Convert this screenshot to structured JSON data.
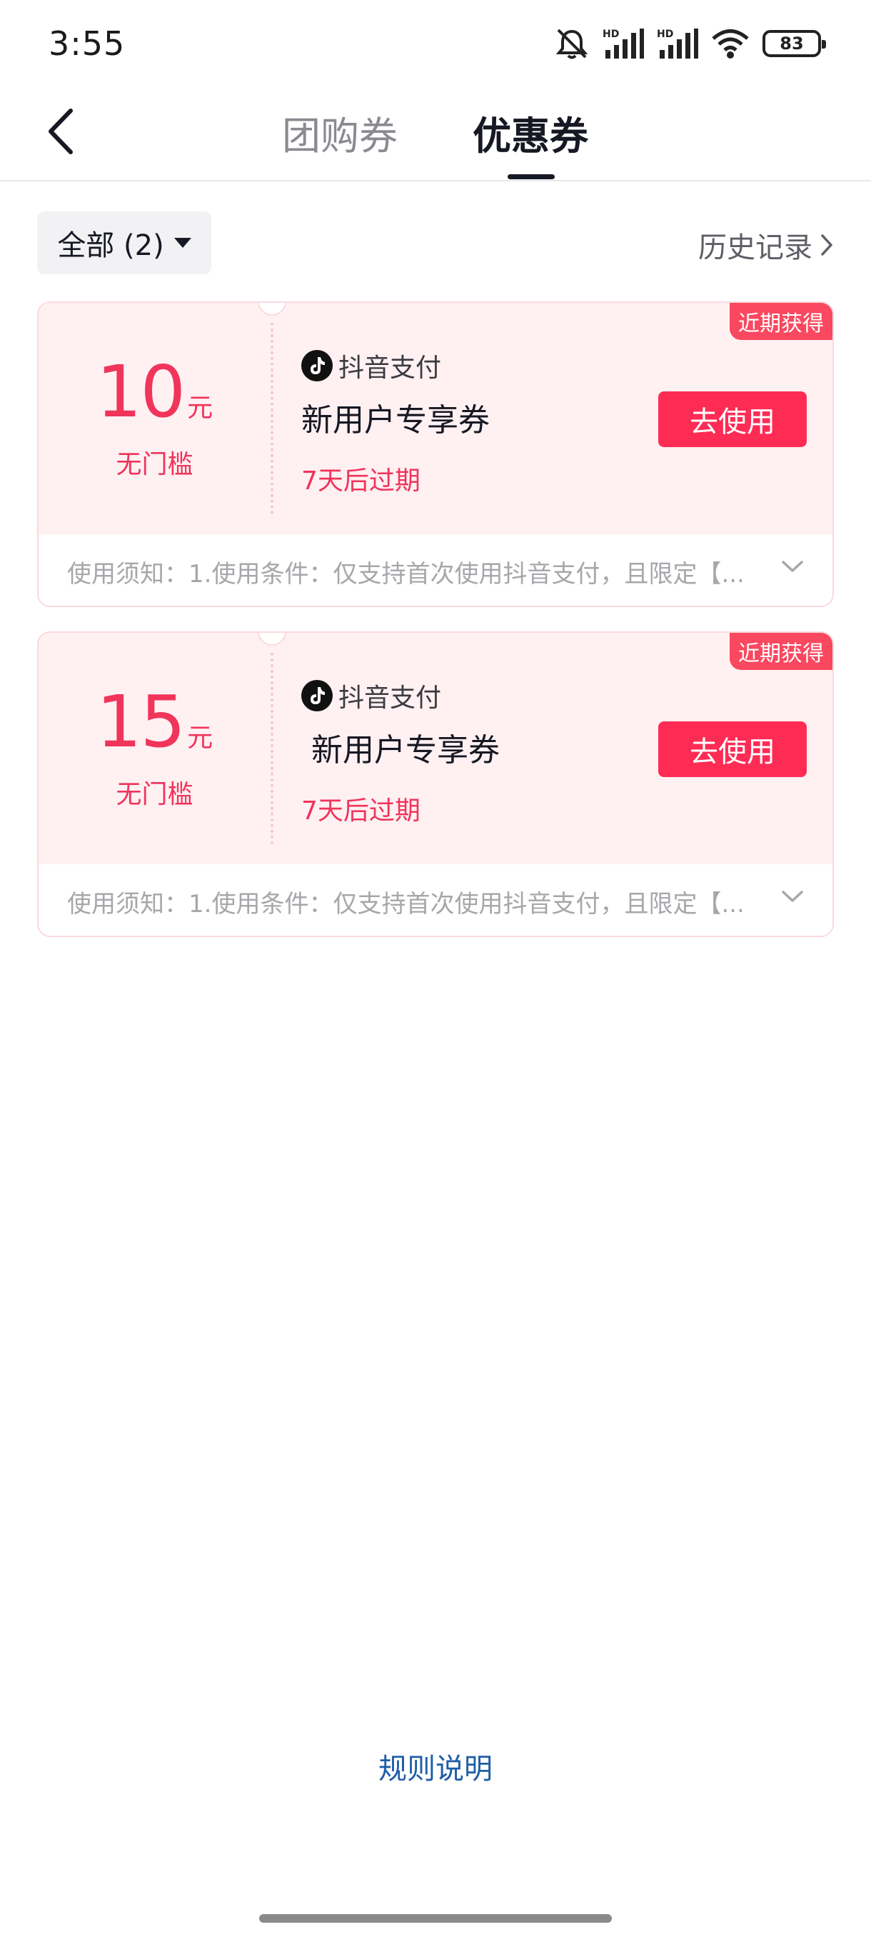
{
  "status_bar": {
    "time": "3:55",
    "battery_level": "83",
    "icons": [
      "mute-icon",
      "signal-hd-icon",
      "signal-hd-icon",
      "wifi-icon",
      "battery-icon"
    ]
  },
  "nav": {
    "tabs": [
      {
        "label": "团购券",
        "active": false
      },
      {
        "label": "优惠券",
        "active": true
      }
    ]
  },
  "filter": {
    "label": "全部 (2)",
    "history_label": "历史记录"
  },
  "coupons": [
    {
      "amount": "10",
      "unit": "元",
      "threshold": "无门槛",
      "brand": "抖音支付",
      "title": "新用户专享券",
      "expiry": "7天后过期",
      "button": "去使用",
      "badge": "近期获得",
      "notice": "使用须知：1.使用条件：仅支持首次使用抖音支付，且限定【..."
    },
    {
      "amount": "15",
      "unit": "元",
      "threshold": "无门槛",
      "brand": "抖音支付",
      "title": "新用户专享券",
      "expiry": "7天后过期",
      "button": "去使用",
      "badge": "近期获得",
      "notice": "使用须知：1.使用条件：仅支持首次使用抖音支付，且限定【..."
    }
  ],
  "footer": {
    "rules_label": "规则说明"
  },
  "colors": {
    "accent": "#fe2c55",
    "coupon_bg": "#fff0f2",
    "badge": "#f9485f",
    "link": "#1f5ea8"
  }
}
